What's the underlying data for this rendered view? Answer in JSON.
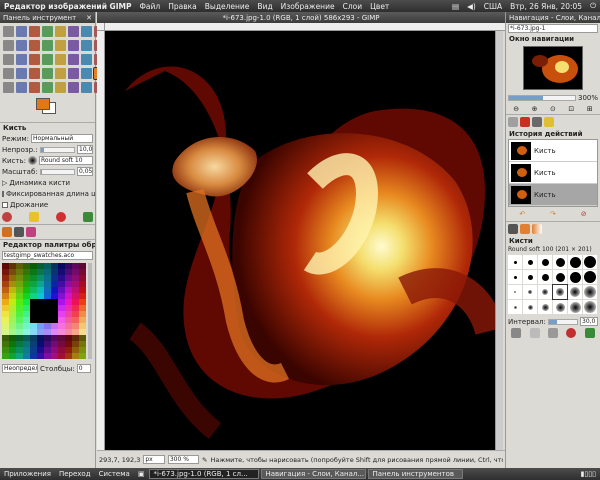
{
  "topbar": {
    "app_title": "Редактор изображений GIMP",
    "menus": [
      "Файл",
      "Правка",
      "Выделение",
      "Вид",
      "Изображение",
      "Слои",
      "Цвет"
    ],
    "keyboard": "США",
    "datetime": "Втр, 26 Янв, 20:05"
  },
  "toolbox": {
    "title": "Панель инструмент",
    "fg_color": "#e07818",
    "bg_color": "#ffffff"
  },
  "brush_tool": {
    "title": "Кисть",
    "mode_label": "Режим:",
    "mode_value": "Нормальный",
    "opacity_label": "Непрозр.:",
    "opacity_value": "10,0",
    "opacity_fraction": 0.1,
    "brush_label": "Кисть:",
    "brush_value": "Round  soft 10",
    "scale_label": "Масштаб:",
    "scale_value": "0,05",
    "scale_fraction": 0.05,
    "dynamics_label": "Динамика кисти",
    "fixed_label": "Фиксированная длина штр",
    "jitter_label": "Дрожание"
  },
  "palette": {
    "title": "Редактор палитры обра...",
    "file": "testgimp_swatches.aco",
    "undefined_label": "Неопределе",
    "columns_label": "Столбцы:",
    "columns_value": "0"
  },
  "image_window": {
    "title": "*i-673.jpg-1.0 (RGB, 1 слой) 586x293 - GIMP",
    "coords": "293,7, 192,3",
    "unit": "px",
    "zoom": "300 %",
    "status": "Нажмите, чтобы нарисовать (попробуйте Shift для рисования прямой линии, Ctrl, что..."
  },
  "navigation": {
    "title": "Навигация - Слои, Каналы",
    "dock_name": "*i-673.jpg-1",
    "panel_title": "Окно навигации",
    "zoom_value": "300%"
  },
  "history": {
    "title": "История действий",
    "items": [
      {
        "label": "Кисть"
      },
      {
        "label": "Кисть"
      },
      {
        "label": "Кисть"
      }
    ]
  },
  "brushes": {
    "title": "Кисти",
    "brush_name": "Round  soft 100 (201 × 201)",
    "spacing_label": "Интервал:",
    "spacing_value": "30,0"
  },
  "taskbar": {
    "apps": "Приложения",
    "places": "Переход",
    "system": "Система",
    "tasks": [
      "*i-673.jpg-1.0 (RGB, 1 сл...",
      "Навигация - Слои, Канал...",
      "Панель инструментов"
    ]
  }
}
